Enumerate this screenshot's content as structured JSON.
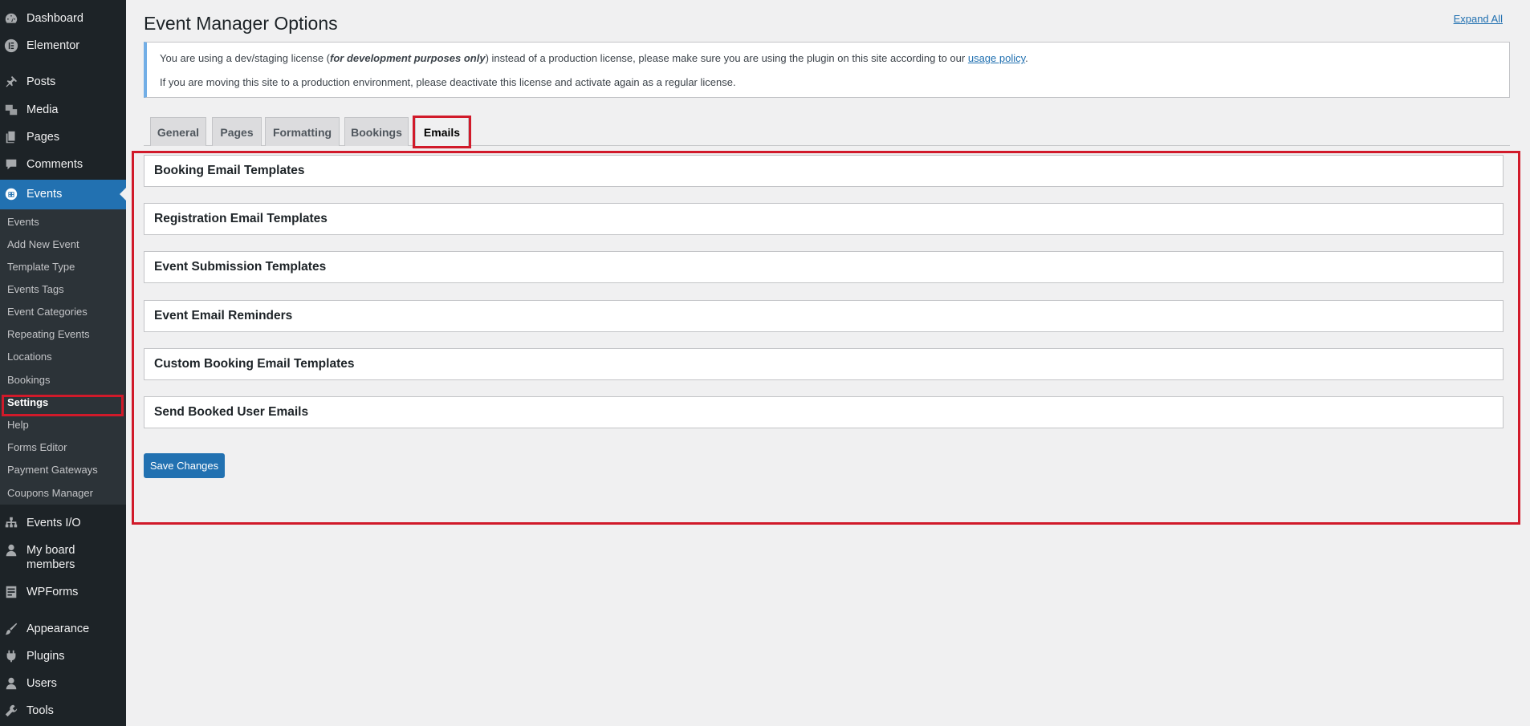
{
  "sidebar": {
    "top_items": [
      {
        "label": "Dashboard",
        "icon": "dashboard-icon"
      },
      {
        "label": "Elementor",
        "icon": "elementor-icon"
      },
      {
        "label": "Posts",
        "icon": "pin-icon"
      },
      {
        "label": "Media",
        "icon": "media-icon"
      },
      {
        "label": "Pages",
        "icon": "pages-icon"
      },
      {
        "label": "Comments",
        "icon": "comment-icon"
      },
      {
        "label": "Events",
        "icon": "calendar-icon"
      }
    ],
    "events_submenu": [
      "Events",
      "Add New Event",
      "Template Type",
      "Events Tags",
      "Event Categories",
      "Repeating Events",
      "Locations",
      "Bookings",
      "Settings",
      "Help",
      "Forms Editor",
      "Payment Gateways",
      "Coupons Manager"
    ],
    "bottom_items": [
      {
        "label": "Events I/O",
        "icon": "sitemap-icon"
      },
      {
        "label_line1": "My board",
        "label_line2": "members",
        "icon": "user-icon"
      },
      {
        "label": "WPForms",
        "icon": "form-icon"
      },
      {
        "label": "Appearance",
        "icon": "brush-icon"
      },
      {
        "label": "Plugins",
        "icon": "plug-icon"
      },
      {
        "label": "Users",
        "icon": "user-icon"
      },
      {
        "label": "Tools",
        "icon": "wrench-icon"
      }
    ],
    "active_color": "#2271b1"
  },
  "header": {
    "title": "Event Manager Options",
    "expand_all": "Expand All"
  },
  "notice": {
    "line1_before": "You are using a dev/staging license (",
    "line1_em": "for development purposes only",
    "line1_middle": ") instead of a production license, please make sure you are using the plugin on this site according to our ",
    "line1_link": "usage policy",
    "line1_after": ".",
    "line2": "If you are moving this site to a production environment, please deactivate this license and activate again as a regular license."
  },
  "tabs": [
    "General",
    "Pages",
    "Formatting",
    "Bookings",
    "Emails"
  ],
  "active_tab": "Emails",
  "panels": [
    "Booking Email Templates",
    "Registration Email Templates",
    "Event Submission Templates",
    "Event Email Reminders",
    "Custom Booking Email Templates",
    "Send Booked User Emails"
  ],
  "save_button": "Save Changes",
  "highlight_color": "#d11a2a"
}
